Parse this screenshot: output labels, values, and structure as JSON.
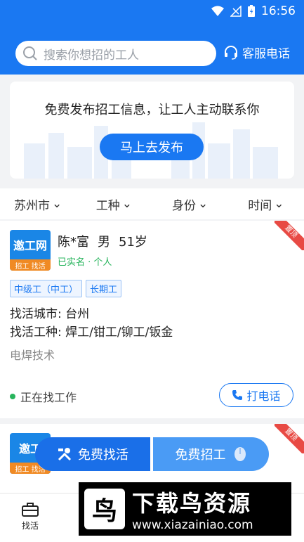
{
  "status_bar": {
    "time": "16:56"
  },
  "header": {
    "search_placeholder": "搜索你想招的工人",
    "service_label": "客服电话"
  },
  "banner": {
    "text": "免费发布招工信息，让工人主动联系你",
    "button": "马上去发布"
  },
  "filters": [
    "苏州市",
    "工种",
    "身份",
    "时间"
  ],
  "worker_card": {
    "avatar_top": "邀工网",
    "avatar_bottom": "招工 找活",
    "name": "陈*富",
    "gender": "男",
    "age": "51岁",
    "verified": "已实名 · 个人",
    "ribbon": "置顶",
    "tags": [
      "中级工（中工）",
      "长期工"
    ],
    "city_line": "找活城市: 台州",
    "trade_line": "找活工种: 焊工/钳工/铆工/钣金",
    "skill": "电焊技术",
    "status": "正在找工作",
    "call_button": "打电话"
  },
  "second_card": {
    "avatar_top": "邀工",
    "avatar_bottom": "招工 找活",
    "ribbon": "置顶"
  },
  "floating": {
    "find_work": "免费找活",
    "hire": "免费招工"
  },
  "tabbar": {
    "find_label": "找活"
  },
  "watermark": {
    "logo": "鸟",
    "title": "下载鸟资源",
    "url": "www.xiazainiao.com"
  },
  "colors": {
    "primary": "#1a78f2",
    "green": "#27b45c",
    "ribbon": "#e84a44"
  }
}
